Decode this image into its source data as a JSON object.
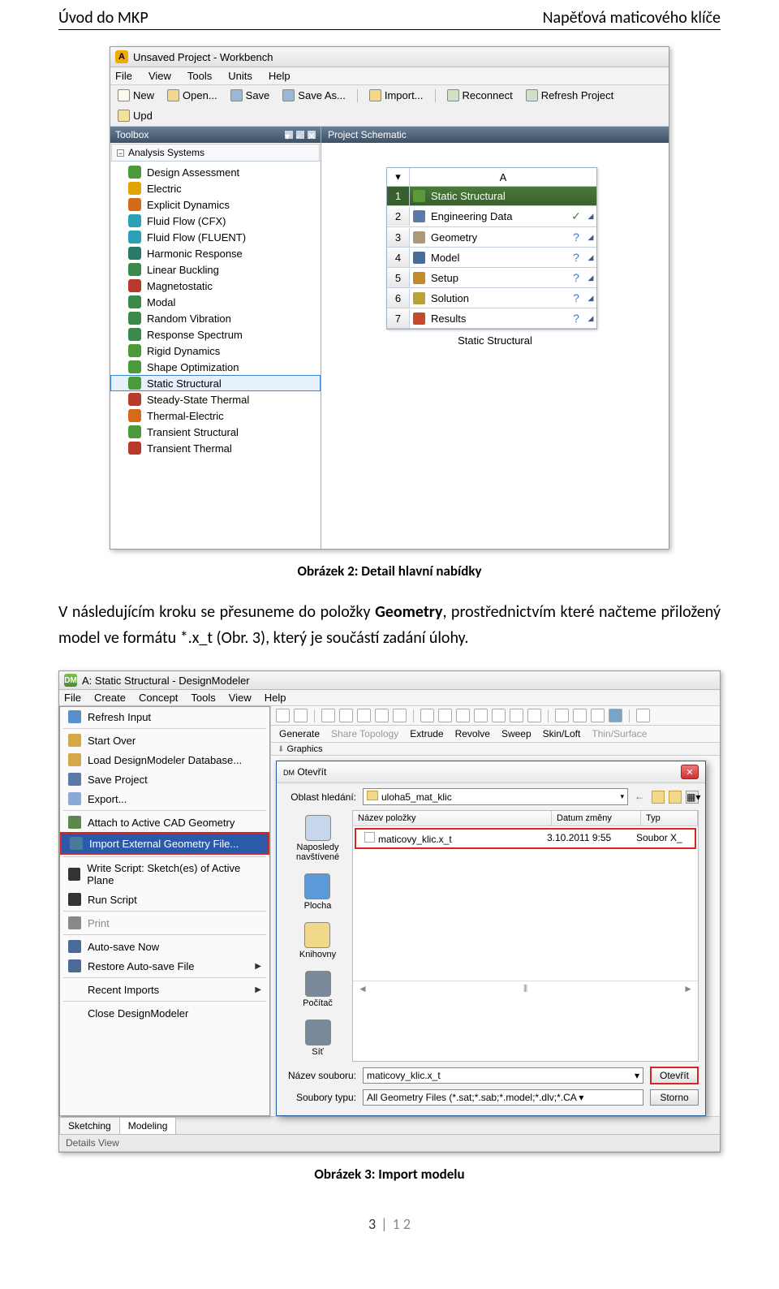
{
  "header": {
    "left": "Úvod do MKP",
    "right": "Napěťová maticového klíče"
  },
  "workbench": {
    "title": "Unsaved Project - Workbench",
    "menus": [
      "File",
      "View",
      "Tools",
      "Units",
      "Help"
    ],
    "toolbar": [
      "New",
      "Open...",
      "Save",
      "Save As...",
      "Import...",
      "Reconnect",
      "Refresh Project",
      "Upd"
    ],
    "panels": {
      "toolbox": "Toolbox",
      "schematic": "Project Schematic"
    },
    "tbx_group": "Analysis Systems",
    "tbx_items": [
      {
        "label": "Design Assessment",
        "color": "#4a9a3a"
      },
      {
        "label": "Electric",
        "color": "#e2a200"
      },
      {
        "label": "Explicit Dynamics",
        "color": "#d46a1a"
      },
      {
        "label": "Fluid Flow (CFX)",
        "color": "#2aa0b8"
      },
      {
        "label": "Fluid Flow (FLUENT)",
        "color": "#2aa0b8"
      },
      {
        "label": "Harmonic Response",
        "color": "#2a7a6a"
      },
      {
        "label": "Linear Buckling",
        "color": "#3a8a4a"
      },
      {
        "label": "Magnetostatic",
        "color": "#b83a2a"
      },
      {
        "label": "Modal",
        "color": "#3a8a4a"
      },
      {
        "label": "Random Vibration",
        "color": "#3a8a4a"
      },
      {
        "label": "Response Spectrum",
        "color": "#3a8a4a"
      },
      {
        "label": "Rigid Dynamics",
        "color": "#4a9a3a"
      },
      {
        "label": "Shape Optimization",
        "color": "#4a9a3a"
      },
      {
        "label": "Static Structural",
        "color": "#4a9a3a",
        "hl": true
      },
      {
        "label": "Steady-State Thermal",
        "color": "#b83a2a"
      },
      {
        "label": "Thermal-Electric",
        "color": "#d46a1a"
      },
      {
        "label": "Transient Structural",
        "color": "#4a9a3a"
      },
      {
        "label": "Transient Thermal",
        "color": "#b83a2a"
      }
    ],
    "schematic": {
      "col": "A",
      "header": "Static Structural",
      "rows": [
        {
          "num": "1"
        },
        {
          "num": "2",
          "label": "Engineering Data",
          "status": "✓",
          "ic": "#5a7aaa"
        },
        {
          "num": "3",
          "label": "Geometry",
          "status": "?",
          "ic": "#a89a7a"
        },
        {
          "num": "4",
          "label": "Model",
          "status": "?",
          "ic": "#4a6a9a"
        },
        {
          "num": "5",
          "label": "Setup",
          "status": "?",
          "ic": "#c48a2a"
        },
        {
          "num": "6",
          "label": "Solution",
          "status": "?",
          "ic": "#b8a23a"
        },
        {
          "num": "7",
          "label": "Results",
          "status": "?",
          "ic": "#c44a2a"
        }
      ],
      "caption": "Static Structural"
    }
  },
  "caption1": "Obrázek 2: Detail hlavní nabídky",
  "paragraph": "V následujícím kroku se přesuneme do položky Geometry, prostřednictvím které načteme přiložený model ve formátu *.x_t (Obr. 3), který je součástí zadání úlohy.",
  "paragraph_bold": "Geometry",
  "dm": {
    "title": "A: Static Structural - DesignModeler",
    "menus": [
      "File",
      "Create",
      "Concept",
      "Tools",
      "View",
      "Help"
    ],
    "file_items": [
      {
        "label": "Refresh Input",
        "ic": "#5a8fce"
      },
      {
        "sep": true
      },
      {
        "label": "Start Over",
        "ic": "#d4a84a"
      },
      {
        "label": "Load DesignModeler Database...",
        "ic": "#d4a84a"
      },
      {
        "label": "Save Project",
        "ic": "#5a7aaa"
      },
      {
        "label": "Export...",
        "ic": "#8aaad4"
      },
      {
        "sep": true
      },
      {
        "label": "Attach to Active CAD Geometry",
        "ic": "#5a8a4a"
      },
      {
        "label": "Import External Geometry File...",
        "ic": "#4a7a9a",
        "hl": true
      },
      {
        "sep": true
      },
      {
        "label": "Write Script: Sketch(es) of Active Plane",
        "ic": "#333"
      },
      {
        "label": "Run Script",
        "ic": "#333"
      },
      {
        "sep": true
      },
      {
        "label": "Print",
        "ic": "#888",
        "gray": true
      },
      {
        "sep": true
      },
      {
        "label": "Auto-save Now",
        "ic": "#4a6a9a"
      },
      {
        "label": "Restore Auto-save File",
        "ic": "#4a6a9a",
        "arrow": true
      },
      {
        "sep": true
      },
      {
        "label": "Recent Imports",
        "arrow": true
      },
      {
        "sep": true
      },
      {
        "label": "Close DesignModeler"
      }
    ],
    "gen_toolbar": [
      "Generate",
      "Share Topology",
      "Extrude",
      "Revolve",
      "Sweep",
      "Skin/Loft",
      "Thin/Surface"
    ],
    "graphics_label": "Graphics",
    "open": {
      "title": "Otevřít",
      "look_in_label": "Oblast hledání:",
      "look_in": "uloha5_mat_klic",
      "cols": [
        "Název položky",
        "Datum změny",
        "Typ"
      ],
      "row": {
        "name": "maticovy_klic.x_t",
        "date": "3.10.2011 9:55",
        "type": "Soubor X_"
      },
      "side": [
        "Naposledy navštívené",
        "Plocha",
        "Knihovny",
        "Počítač",
        "Síť"
      ],
      "filename_label": "Název souboru:",
      "filename": "maticovy_klic.x_t",
      "filetype_label": "Soubory typu:",
      "filetype": "All Geometry Files (*.sat;*.sab;*.model;*.dlv;*.CA ▾",
      "btn_open": "Otevřít",
      "btn_cancel": "Storno"
    },
    "tabs": [
      "Sketching",
      "Modeling"
    ],
    "details": "Details View"
  },
  "caption2": "Obrázek 3: Import modelu",
  "footer": {
    "page": "3",
    "sep": "|",
    "total": "1 2"
  }
}
